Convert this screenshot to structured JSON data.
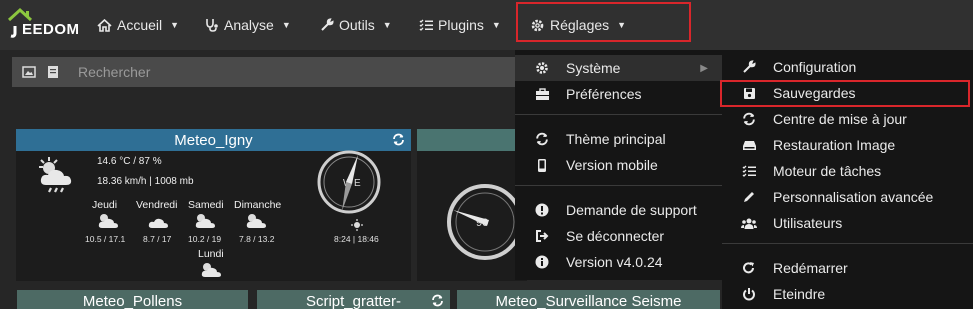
{
  "brand": {
    "logo_text": "EEDOM"
  },
  "nav": {
    "items": [
      {
        "label": "Accueil",
        "icon": "home-icon"
      },
      {
        "label": "Analyse",
        "icon": "stethoscope-icon"
      },
      {
        "label": "Outils",
        "icon": "wrench-icon"
      },
      {
        "label": "Plugins",
        "icon": "tasks-icon"
      },
      {
        "label": "Réglages",
        "icon": "cogs-icon"
      }
    ]
  },
  "search": {
    "placeholder": "Rechercher"
  },
  "widgets": {
    "meteo_igny": {
      "title": "Meteo_Igny",
      "current": {
        "temp_humidity": "14.6 °C / 87 %",
        "wind_pressure": "18.36 km/h | 1008 mb"
      },
      "forecast": [
        {
          "day": "Jeudi",
          "range": "10.5 / 17.1"
        },
        {
          "day": "Vendredi",
          "range": "8.7 / 17"
        },
        {
          "day": "Samedi",
          "range": "10.2 / 19"
        },
        {
          "day": "Dimanche",
          "range": "7.8 / 13.2"
        },
        {
          "day": "Lundi",
          "range": ""
        }
      ],
      "sun": "8:24 | 18:46"
    },
    "gauge": {
      "value": "90"
    },
    "bottom": [
      {
        "title": "Meteo_Pollens"
      },
      {
        "title": "Script_gratter-"
      },
      {
        "title": "Meteo_Surveillance Seisme"
      }
    ]
  },
  "menu_reglages": {
    "items": [
      {
        "label": "Système",
        "icon": "cog-icon",
        "has_submenu": true
      },
      {
        "label": "Préférences",
        "icon": "briefcase-icon"
      },
      {
        "label": "Thème principal",
        "icon": "sync-icon"
      },
      {
        "label": "Version mobile",
        "icon": "mobile-icon"
      },
      {
        "label": "Demande de support",
        "icon": "exclamation-circle-icon"
      },
      {
        "label": "Se déconnecter",
        "icon": "sign-out-icon"
      },
      {
        "label": "Version v4.0.24",
        "icon": "info-circle-icon"
      }
    ]
  },
  "menu_systeme": {
    "items": [
      {
        "label": "Configuration",
        "icon": "wrench-icon"
      },
      {
        "label": "Sauvegardes",
        "icon": "floppy-disk-icon"
      },
      {
        "label": "Centre de mise à jour",
        "icon": "refresh-icon"
      },
      {
        "label": "Restauration Image",
        "icon": "hdd-icon"
      },
      {
        "label": "Moteur de tâches",
        "icon": "list-icon"
      },
      {
        "label": "Personnalisation avancée",
        "icon": "pencil-icon"
      },
      {
        "label": "Utilisateurs",
        "icon": "users-icon"
      },
      {
        "label": "Redémarrer",
        "icon": "redo-icon"
      },
      {
        "label": "Eteindre",
        "icon": "power-icon"
      }
    ]
  },
  "colors": {
    "highlight_border": "#d9262b",
    "meteo_header": "#2f6f95"
  }
}
